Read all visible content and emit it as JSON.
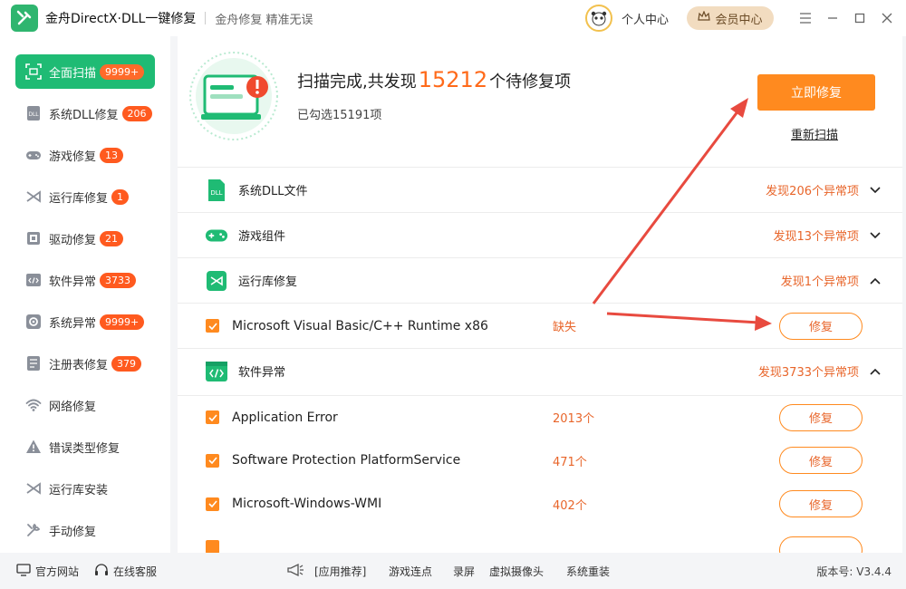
{
  "titlebar": {
    "app_title": "金舟DirectX·DLL一键修复",
    "slogan": "金舟修复 精准无误",
    "personal_center": "个人中心",
    "vip_center": "会员中心"
  },
  "sidebar": {
    "items": [
      {
        "label": "全面扫描",
        "badge": "9999+",
        "icon": "scan-icon"
      },
      {
        "label": "系统DLL修复",
        "badge": "206",
        "icon": "dll-icon"
      },
      {
        "label": "游戏修复",
        "badge": "13",
        "icon": "gamepad-icon"
      },
      {
        "label": "运行库修复",
        "badge": "1",
        "icon": "runtime-icon"
      },
      {
        "label": "驱动修复",
        "badge": "21",
        "icon": "driver-icon"
      },
      {
        "label": "软件异常",
        "badge": "3733",
        "icon": "code-icon"
      },
      {
        "label": "系统异常",
        "badge": "9999+",
        "icon": "gear-icon"
      },
      {
        "label": "注册表修复",
        "badge": "379",
        "icon": "registry-icon"
      },
      {
        "label": "网络修复",
        "badge": "",
        "icon": "wifi-icon"
      },
      {
        "label": "错误类型修复",
        "badge": "",
        "icon": "warning-icon"
      },
      {
        "label": "运行库安装",
        "badge": "",
        "icon": "install-icon"
      },
      {
        "label": "手动修复",
        "badge": "",
        "icon": "wrench-icon"
      }
    ]
  },
  "scan": {
    "title_prefix": "扫描完成,共发现",
    "count": "15212",
    "title_suffix": "个待修复项",
    "selected": "已勾选15191项",
    "fix_now": "立即修复",
    "rescan": "重新扫描"
  },
  "categories": {
    "dll": {
      "label": "系统DLL文件",
      "status": "发现206个异常项"
    },
    "game": {
      "label": "游戏组件",
      "status": "发现13个异常项"
    },
    "runtime": {
      "label": "运行库修复",
      "status": "发现1个异常项"
    },
    "software": {
      "label": "软件异常",
      "status": "发现3733个异常项"
    }
  },
  "items": {
    "vc": {
      "label": "Microsoft Visual Basic/C++ Runtime x86",
      "count": "缺失"
    },
    "app_error": {
      "label": "Application Error",
      "count": "2013个"
    },
    "spps": {
      "label": "Software Protection PlatformService",
      "count": "471个"
    },
    "wmi": {
      "label": "Microsoft-Windows-WMI",
      "count": "402个"
    }
  },
  "fix_label": "修复",
  "footer": {
    "website": "官方网站",
    "support": "在线客服",
    "app_recommend": "[应用推荐]",
    "links": [
      "游戏连点",
      "录屏",
      "虚拟摄像头",
      "系统重装"
    ],
    "version": "版本号: V3.4.4"
  },
  "colors": {
    "accent_green": "#1fbb74",
    "accent_orange": "#ff8a1f",
    "badge_red": "#ff5a1f",
    "arrow_red": "#e84a3f"
  }
}
